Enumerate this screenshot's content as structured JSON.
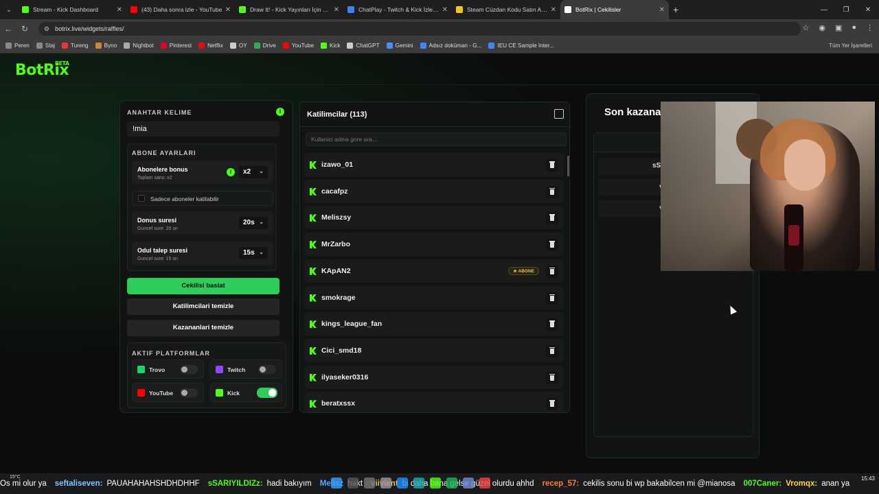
{
  "browser": {
    "tabs": [
      {
        "title": "Stream - Kick Dashboard",
        "color": "#53fc18"
      },
      {
        "title": "(43) Daha sonra izle - YouTube",
        "color": "#ff0000"
      },
      {
        "title": "Draw It! - Kick Yayınları İçin Çizi",
        "color": "#53fc18"
      },
      {
        "title": "ChatPlay - Twitch & Kick İzleyic",
        "color": "#3b82f6"
      },
      {
        "title": "Steam Cüzdan Kodu Satın Al (C",
        "color": "#f5c518"
      },
      {
        "title": "BotRix | Cekilisler",
        "color": "#ffffff"
      }
    ],
    "active_tab": 5,
    "url": "botrix.live/widgets/raffles/",
    "bookmarks": [
      "Peren",
      "Staj",
      "Tureng",
      "Byno",
      "Nightbot",
      "Pinterest",
      "Netflix",
      "OY",
      "Drive",
      "YouTube",
      "Kick",
      "ChatGPT",
      "Gemini",
      "Adsız doküman - G...",
      "IEU CE Sample Inter..."
    ],
    "bookmarks_right": "Tüm Yer İşaretleri"
  },
  "app": {
    "logo": "BotRix",
    "logo_badge": "BETA"
  },
  "settings": {
    "keyword_label": "ANAHTAR KELIME",
    "keyword_value": "!mia",
    "sub_section": "ABONE AYARLARI",
    "sub_bonus_title": "Abonelere bonus",
    "sub_bonus_sub": "Toplam sans: x2",
    "sub_bonus_value": "x2",
    "sub_only_label": "Sadece aboneler katilabilir",
    "spin_title": "Donus suresi",
    "spin_sub": "Guncel sure: 20 sn",
    "spin_value": "20s",
    "claim_title": "Odul talep suresi",
    "claim_sub": "Guncel sure: 15 sn",
    "claim_value": "15s",
    "start_btn": "Cekilisi baslat",
    "clear_participants_btn": "Katilimcilari temizle",
    "clear_winners_btn": "Kazananlari temizle",
    "platforms_title": "AKTIF PLATFORMLAR",
    "platforms": [
      {
        "name": "Trovo",
        "on": false,
        "color": "#19d66b"
      },
      {
        "name": "Twitch",
        "on": false,
        "color": "#9146ff"
      },
      {
        "name": "YouTube",
        "on": false,
        "color": "#ff0000"
      },
      {
        "name": "Kick",
        "on": true,
        "color": "#53fc18"
      }
    ]
  },
  "participants": {
    "title": "Katilimcilar (113)",
    "search_placeholder": "Kullanici adina gore ara...",
    "sub_badge": "ABONE",
    "list": [
      {
        "name": "izawo_01",
        "sub": false
      },
      {
        "name": "cacafpz",
        "sub": false
      },
      {
        "name": "Meliszsy",
        "sub": false
      },
      {
        "name": "MrZarbo",
        "sub": false
      },
      {
        "name": "KApAN2",
        "sub": true
      },
      {
        "name": "smokrage",
        "sub": false
      },
      {
        "name": "kings_league_fan",
        "sub": false
      },
      {
        "name": "Cici_smd18",
        "sub": false
      },
      {
        "name": "ilyaseker0316",
        "sub": false
      },
      {
        "name": "beratxssx",
        "sub": false
      }
    ]
  },
  "winners": {
    "title": "Son kazana",
    "head": "Son",
    "list": [
      "sSARIYILDIZ",
      "viiviento",
      "viiviento"
    ]
  },
  "taskbar": {
    "weather": "15°C",
    "chat": [
      {
        "user": "",
        "msg": "Os mi olur ya",
        "color": "#ffffff"
      },
      {
        "user": "seftaliseven:",
        "msg": "PAUAHAHAHSHDHDHHF",
        "color": "#7ec8ff"
      },
      {
        "user": "sSARIYILDIZz:",
        "msg": "hadi bakıyım",
        "color": "#53fc18"
      },
      {
        "user": "Melisz",
        "msg": "hakt",
        "color": "#5aa7ff"
      },
      {
        "user": "viivient",
        "msg": "bi daha bana gelse güzel olurdu ahhd",
        "color": "#e7c25a"
      },
      {
        "user": "recep_57:",
        "msg": "cekilis sonu bi wp bakabilcen mi @mianosa",
        "color": "#ff7d3a"
      },
      {
        "user": "007Caner:",
        "msg": "",
        "color": "#53fc18"
      },
      {
        "user": "Vromqx:",
        "msg": "anan ya",
        "color": "#ffd24a"
      }
    ],
    "time": "15:43"
  }
}
